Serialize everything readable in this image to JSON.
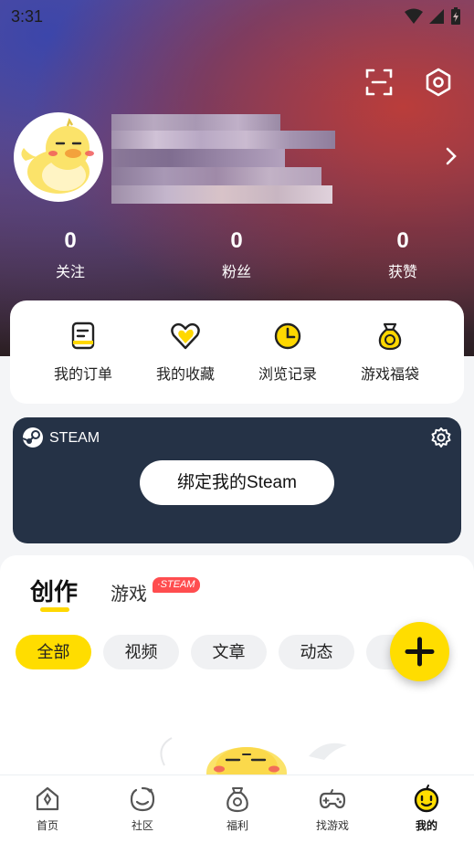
{
  "status_bar": {
    "time": "3:31"
  },
  "profile": {
    "stats": [
      {
        "value": "0",
        "label": "关注"
      },
      {
        "value": "0",
        "label": "粉丝"
      },
      {
        "value": "0",
        "label": "获赞"
      }
    ]
  },
  "quick_actions": [
    {
      "label": "我的订单",
      "icon": "order-icon"
    },
    {
      "label": "我的收藏",
      "icon": "heart-icon"
    },
    {
      "label": "浏览记录",
      "icon": "clock-icon"
    },
    {
      "label": "游戏福袋",
      "icon": "lucky-bag-icon"
    }
  ],
  "steam": {
    "label": "STEAM",
    "bind_button": "绑定我的Steam"
  },
  "tabs": {
    "create": "创作",
    "game": "游戏",
    "game_badge": "·STEAM"
  },
  "filters": [
    "全部",
    "视频",
    "文章",
    "动态",
    "刀"
  ],
  "bottom_nav": [
    {
      "label": "首页",
      "icon": "home-icon"
    },
    {
      "label": "社区",
      "icon": "community-icon"
    },
    {
      "label": "福利",
      "icon": "welfare-icon"
    },
    {
      "label": "找游戏",
      "icon": "gamepad-icon"
    },
    {
      "label": "我的",
      "icon": "mine-icon"
    }
  ],
  "colors": {
    "accent": "#ffdd00",
    "steam_bg": "#253246",
    "badge": "#ff4d4f"
  }
}
